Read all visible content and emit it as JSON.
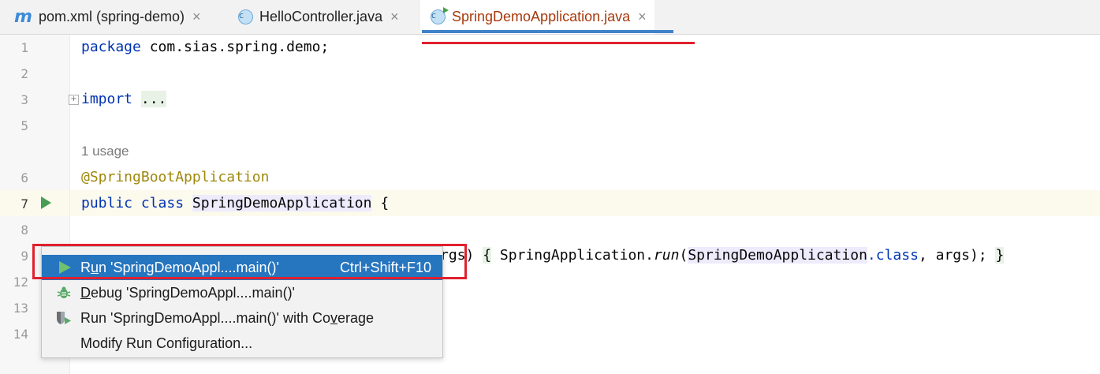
{
  "tabs": [
    {
      "label": "pom.xml (spring-demo)",
      "icon": "maven-icon",
      "active": false
    },
    {
      "label": "HelloController.java",
      "icon": "java-class-icon",
      "active": false
    },
    {
      "label": "SpringDemoApplication.java",
      "icon": "java-runnable-class-icon",
      "active": true
    }
  ],
  "icon_glyphs": {
    "maven": "m",
    "java_class": "c",
    "close": "×",
    "fold": "+"
  },
  "gutter": {
    "line_numbers": [
      "1",
      "2",
      "3",
      "5",
      "6",
      "7",
      "8",
      "9",
      "12",
      "13",
      "14"
    ]
  },
  "code": {
    "l1_kw": "package",
    "l1_rest": " com.sias.spring.demo;",
    "l3_kw": "import",
    "l3_fold": "...",
    "usage_hint": "1 usage",
    "l6_annotation": "@SpringBootApplication",
    "l7_kw1": "public",
    "l7_kw2": "class",
    "l7_class": "SpringDemoApplication",
    "l7_brace": " {",
    "l9_visible_args": "rgs)",
    "l9_brace_open": "{",
    "l9_spring_app": "SpringApplication.",
    "l9_run": "run",
    "l9_paren": "(",
    "l9_class_ref": "SpringDemoApplication",
    "l9_dot_class": ".class",
    "l9_args_end": ", args); ",
    "l9_brace_close": "}"
  },
  "context_menu": {
    "items": [
      {
        "label_prefix": "R",
        "label_mnemonic": "u",
        "label_suffix": "n 'SpringDemoAppl....main()'",
        "shortcut": "Ctrl+Shift+F10",
        "icon": "run-icon",
        "selected": true
      },
      {
        "label_prefix": "",
        "label_mnemonic": "D",
        "label_suffix": "ebug 'SpringDemoAppl....main()'",
        "shortcut": "",
        "icon": "debug-icon",
        "selected": false
      },
      {
        "label_prefix": "Run 'SpringDemoAppl....main()' with Co",
        "label_mnemonic": "v",
        "label_suffix": "erage",
        "shortcut": "",
        "icon": "coverage-icon",
        "selected": false
      },
      {
        "label_prefix": "Modify Run Configuration...",
        "label_mnemonic": "",
        "label_suffix": "",
        "shortcut": "",
        "icon": "",
        "selected": false
      }
    ]
  },
  "colors": {
    "keyword": "#0033b3",
    "annotation": "#9e880d",
    "selection": "#2675bf",
    "highlight_red": "#e0202e",
    "run_green": "#499c54"
  }
}
